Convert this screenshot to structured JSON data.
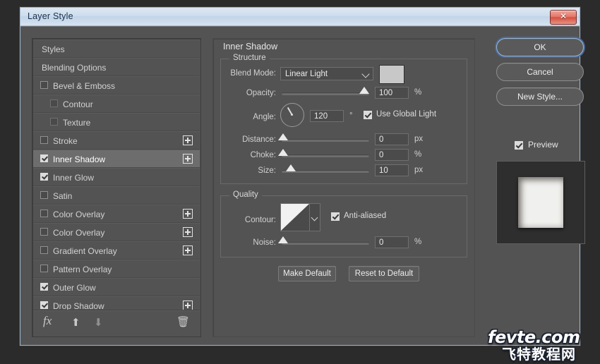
{
  "window": {
    "title": "Layer Style",
    "close_label": "✕"
  },
  "styles_panel": {
    "items": [
      {
        "label": "Styles",
        "type": "header",
        "checked": null,
        "plus": false,
        "selected": false,
        "indent": false
      },
      {
        "label": "Blending Options",
        "type": "header",
        "checked": null,
        "plus": false,
        "selected": false,
        "indent": false
      },
      {
        "label": "Bevel & Emboss",
        "type": "effect",
        "checked": false,
        "plus": false,
        "selected": false,
        "indent": false
      },
      {
        "label": "Contour",
        "type": "sub",
        "checked": false,
        "plus": false,
        "selected": false,
        "indent": true
      },
      {
        "label": "Texture",
        "type": "sub",
        "checked": false,
        "plus": false,
        "selected": false,
        "indent": true
      },
      {
        "label": "Stroke",
        "type": "effect",
        "checked": false,
        "plus": true,
        "selected": false,
        "indent": false
      },
      {
        "label": "Inner Shadow",
        "type": "effect",
        "checked": true,
        "plus": true,
        "selected": true,
        "indent": false
      },
      {
        "label": "Inner Glow",
        "type": "effect",
        "checked": true,
        "plus": false,
        "selected": false,
        "indent": false
      },
      {
        "label": "Satin",
        "type": "effect",
        "checked": false,
        "plus": false,
        "selected": false,
        "indent": false
      },
      {
        "label": "Color Overlay",
        "type": "effect",
        "checked": false,
        "plus": true,
        "selected": false,
        "indent": false
      },
      {
        "label": "Color Overlay",
        "type": "effect",
        "checked": false,
        "plus": true,
        "selected": false,
        "indent": false
      },
      {
        "label": "Gradient Overlay",
        "type": "effect",
        "checked": false,
        "plus": true,
        "selected": false,
        "indent": false
      },
      {
        "label": "Pattern Overlay",
        "type": "effect",
        "checked": false,
        "plus": false,
        "selected": false,
        "indent": false
      },
      {
        "label": "Outer Glow",
        "type": "effect",
        "checked": true,
        "plus": false,
        "selected": false,
        "indent": false
      },
      {
        "label": "Drop Shadow",
        "type": "effect",
        "checked": true,
        "plus": true,
        "selected": false,
        "indent": false
      }
    ],
    "toolbar": {
      "fx": "fx",
      "move_up": "⬆",
      "move_down": "⬇",
      "delete": "🗑"
    }
  },
  "effect": {
    "title": "Inner Shadow",
    "structure": {
      "legend": "Structure",
      "blend_mode_label": "Blend Mode:",
      "blend_mode_value": "Linear Light",
      "blend_color": "#c8c8c8",
      "opacity_label": "Opacity:",
      "opacity_value": "100",
      "opacity_unit": "%",
      "angle_label": "Angle:",
      "angle_value": "120",
      "angle_unit": "°",
      "use_global_light_label": "Use Global Light",
      "use_global_light_checked": true,
      "distance_label": "Distance:",
      "distance_value": "0",
      "distance_unit": "px",
      "choke_label": "Choke:",
      "choke_value": "0",
      "choke_unit": "%",
      "size_label": "Size:",
      "size_value": "10",
      "size_unit": "px"
    },
    "quality": {
      "legend": "Quality",
      "contour_label": "Contour:",
      "anti_aliased_label": "Anti-aliased",
      "anti_aliased_checked": true,
      "noise_label": "Noise:",
      "noise_value": "0",
      "noise_unit": "%"
    },
    "make_default_label": "Make Default",
    "reset_to_default_label": "Reset to Default"
  },
  "actions": {
    "ok_label": "OK",
    "cancel_label": "Cancel",
    "new_style_label": "New Style...",
    "preview_label": "Preview",
    "preview_checked": true
  },
  "watermark": {
    "line1": "fevte.com",
    "line2": "飞特教程网"
  }
}
